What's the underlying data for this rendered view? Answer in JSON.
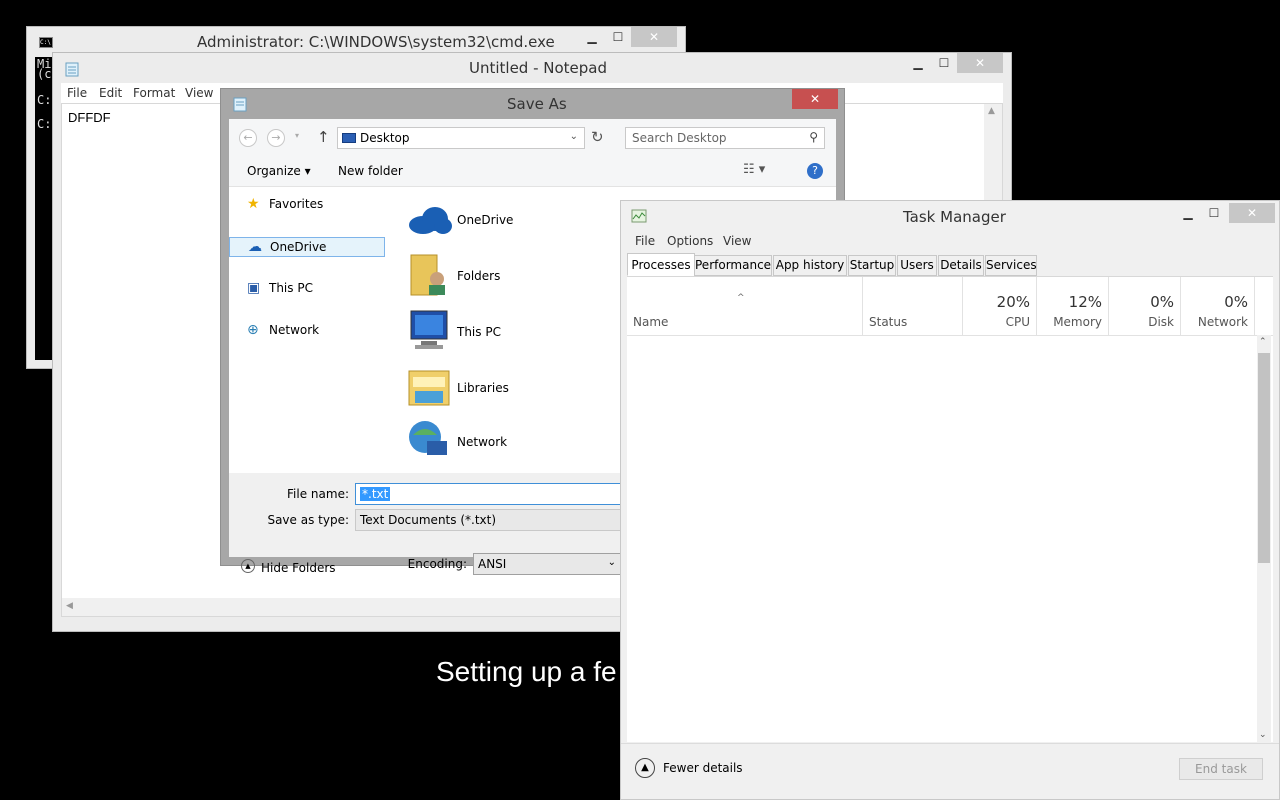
{
  "background_text": "Setting up a fe",
  "cmd": {
    "title": "Administrator: C:\\WINDOWS\\system32\\cmd.exe",
    "lines": [
      "Mi",
      "(c",
      "C:",
      "C:"
    ]
  },
  "notepad": {
    "title": "Untitled - Notepad",
    "menu": [
      "File",
      "Edit",
      "Format",
      "View"
    ],
    "content": "DFFDF"
  },
  "saveas": {
    "title": "Save As",
    "address": "Desktop",
    "search_placeholder": "Search Desktop",
    "organize": "Organize ▾",
    "new_folder": "New folder",
    "nav": [
      "Favorites",
      "OneDrive",
      "This PC",
      "Network"
    ],
    "files": [
      "OneDrive",
      "Folders",
      "This PC",
      "Libraries",
      "Network"
    ],
    "file_name_label": "File name:",
    "file_name_value": "*.txt",
    "save_type_label": "Save as type:",
    "save_type_value": "Text Documents (*.txt)",
    "hide_folders": "Hide Folders",
    "encoding_label": "Encoding:",
    "encoding_value": "ANSI"
  },
  "taskmgr": {
    "title": "Task Manager",
    "menu": [
      "File",
      "Options",
      "View"
    ],
    "tabs": [
      "Processes",
      "Performance",
      "App history",
      "Startup",
      "Users",
      "Details",
      "Services"
    ],
    "columns": {
      "name": "Name",
      "status": "Status",
      "cpu_pct": "20%",
      "cpu": "CPU",
      "mem_pct": "12%",
      "mem": "Memory",
      "disk_pct": "0%",
      "disk": "Disk",
      "net_pct": "0%",
      "net": "Network"
    },
    "fewer_details": "Fewer details",
    "end_task": "End task"
  },
  "colors": {
    "close_red": "#c75050",
    "selection_blue": "#3399ff",
    "nav_selected": "#e5f3fb"
  }
}
